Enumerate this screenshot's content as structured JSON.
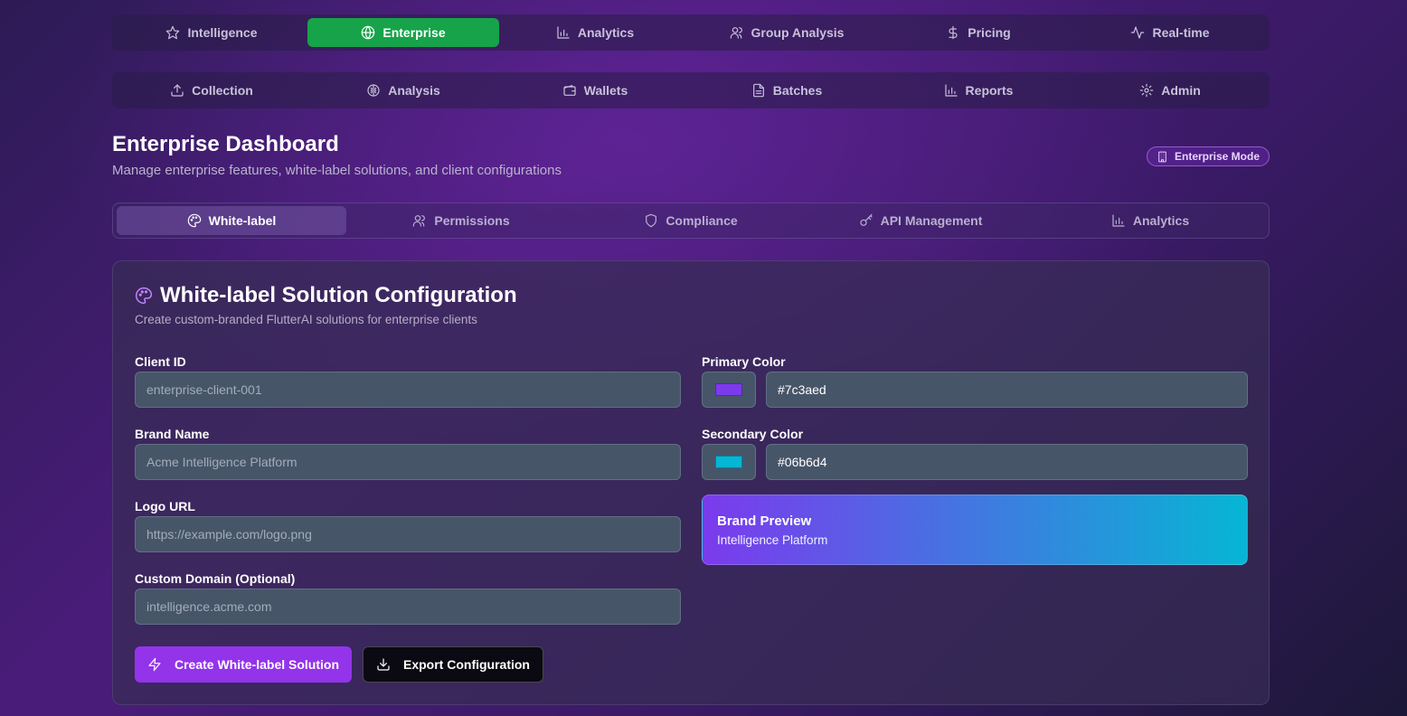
{
  "top_nav": [
    {
      "label": "Intelligence",
      "icon": "star-icon",
      "active": false
    },
    {
      "label": "Enterprise",
      "icon": "globe-icon",
      "active": true
    },
    {
      "label": "Analytics",
      "icon": "bar-chart-icon",
      "active": false
    },
    {
      "label": "Group Analysis",
      "icon": "users-icon",
      "active": false
    },
    {
      "label": "Pricing",
      "icon": "dollar-icon",
      "active": false
    },
    {
      "label": "Real-time",
      "icon": "activity-icon",
      "active": false
    }
  ],
  "second_nav": [
    {
      "label": "Collection",
      "icon": "upload-icon"
    },
    {
      "label": "Analysis",
      "icon": "brain-icon"
    },
    {
      "label": "Wallets",
      "icon": "wallet-icon"
    },
    {
      "label": "Batches",
      "icon": "file-icon"
    },
    {
      "label": "Reports",
      "icon": "bar-chart-icon"
    },
    {
      "label": "Admin",
      "icon": "gear-icon"
    }
  ],
  "header": {
    "title": "Enterprise Dashboard",
    "subtitle": "Manage enterprise features, white-label solutions, and client configurations",
    "mode_badge": "Enterprise Mode"
  },
  "tabs": [
    {
      "label": "White-label",
      "icon": "palette-icon",
      "active": true
    },
    {
      "label": "Permissions",
      "icon": "users-icon",
      "active": false
    },
    {
      "label": "Compliance",
      "icon": "shield-icon",
      "active": false
    },
    {
      "label": "API Management",
      "icon": "key-icon",
      "active": false
    },
    {
      "label": "Analytics",
      "icon": "bar-chart-icon",
      "active": false
    }
  ],
  "card": {
    "title": "White-label Solution Configuration",
    "subtitle": "Create custom-branded FlutterAI solutions for enterprise clients"
  },
  "form": {
    "client_id": {
      "label": "Client ID",
      "placeholder": "enterprise-client-001",
      "value": ""
    },
    "brand_name": {
      "label": "Brand Name",
      "placeholder": "Acme Intelligence Platform",
      "value": ""
    },
    "logo_url": {
      "label": "Logo URL",
      "placeholder": "https://example.com/logo.png",
      "value": ""
    },
    "custom_domain": {
      "label": "Custom Domain (Optional)",
      "placeholder": "intelligence.acme.com",
      "value": ""
    },
    "primary_color": {
      "label": "Primary Color",
      "value": "#7c3aed"
    },
    "secondary_color": {
      "label": "Secondary Color",
      "value": "#06b6d4"
    }
  },
  "preview": {
    "title": "Brand Preview",
    "subtitle": "Intelligence Platform"
  },
  "buttons": {
    "create": "Create White-label Solution",
    "export": "Export Configuration"
  },
  "colors": {
    "accent_green": "#16a34a",
    "primary_button": "#9333ea",
    "primary_brand": "#7c3aed",
    "secondary_brand": "#06b6d4"
  }
}
